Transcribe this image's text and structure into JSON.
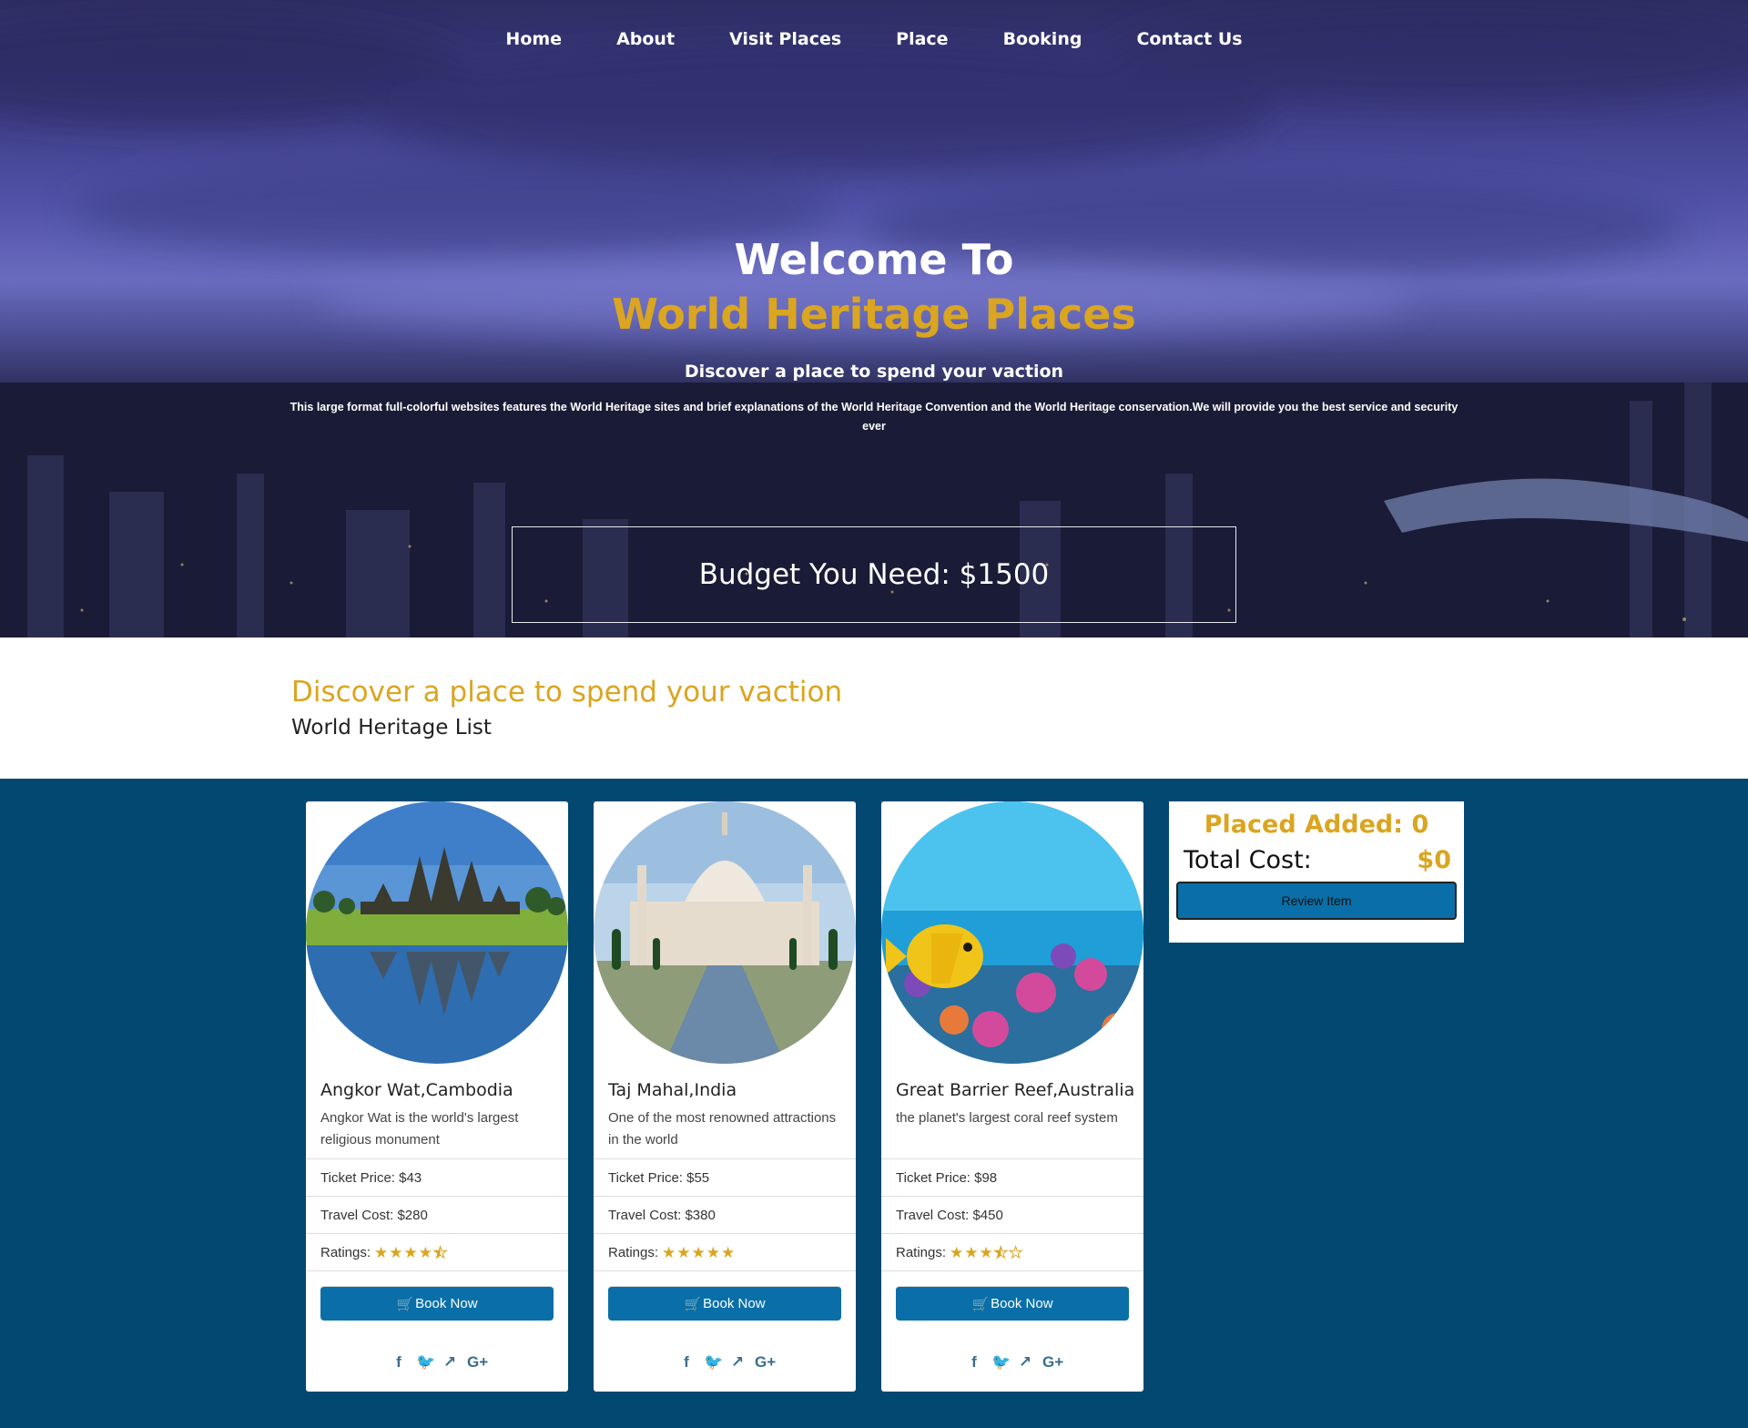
{
  "nav": {
    "items": [
      {
        "label": "Home"
      },
      {
        "label": "About"
      },
      {
        "label": "Visit Places"
      },
      {
        "label": "Place"
      },
      {
        "label": "Booking"
      },
      {
        "label": "Contact Us"
      }
    ]
  },
  "hero": {
    "welcome": "Welcome To",
    "brand": "World Heritage Places",
    "subtitle": "Discover a place to spend your vaction",
    "description": "This large format full-colorful websites features the World Heritage sites and brief explanations of the World Heritage Convention and the World Heritage conservation.We will provide you the best service and security ever",
    "budget": "Budget You Need: $1500"
  },
  "intro": {
    "title": "Discover a place to spend your vaction",
    "subtitle": "World Heritage List"
  },
  "places": [
    {
      "title": "Angkor Wat,Cambodia",
      "description": "Angkor Wat is the world's largest religious monument",
      "ticket": "Ticket Price: $43",
      "travel": "Travel Cost: $280",
      "ratings_label": "Ratings:",
      "rating": 4.5,
      "button": "Book Now"
    },
    {
      "title": "Taj Mahal,India",
      "description": "One of the most renowned attractions in the world",
      "ticket": "Ticket Price: $55",
      "travel": "Travel Cost: $380",
      "ratings_label": "Ratings:",
      "rating": 5,
      "button": "Book Now"
    },
    {
      "title": "Great Barrier Reef,Australia",
      "description": "the planet's largest coral reef system",
      "ticket": "Ticket Price: $98",
      "travel": "Travel Cost: $450",
      "ratings_label": "Ratings:",
      "rating": 3.5,
      "button": "Book Now"
    }
  ],
  "social_icons": [
    "facebook-icon",
    "twitter-icon",
    "share-icon",
    "google-plus-icon"
  ],
  "summary": {
    "added": "Placed Added: 0",
    "total_label": "Total Cost:",
    "total_value": "$0",
    "review_button": "Review Item"
  },
  "colors": {
    "accent": "#daa520",
    "section_bg": "#034870",
    "button": "#0a6fa8"
  }
}
